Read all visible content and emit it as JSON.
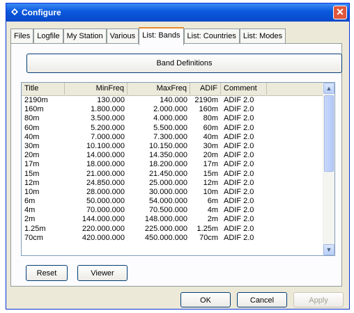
{
  "window": {
    "title": "Configure"
  },
  "tabs": [
    "Files",
    "Logfile",
    "My Station",
    "Various",
    "List: Bands",
    "List: Countries",
    "List: Modes"
  ],
  "active_tab": "List: Bands",
  "band_definitions_label": "Band Definitions",
  "columns": [
    "Title",
    "MinFreq",
    "MaxFreq",
    "ADIF",
    "Comment"
  ],
  "rows": [
    [
      "2190m",
      "130.000",
      "140.000",
      "2190m",
      "ADIF 2.0"
    ],
    [
      "160m",
      "1.800.000",
      "2.000.000",
      "160m",
      "ADIF 2.0"
    ],
    [
      "80m",
      "3.500.000",
      "4.000.000",
      "80m",
      "ADIF 2.0"
    ],
    [
      "60m",
      "5.200.000",
      "5.500.000",
      "60m",
      "ADIF 2.0"
    ],
    [
      "40m",
      "7.000.000",
      "7.300.000",
      "40m",
      "ADIF 2.0"
    ],
    [
      "30m",
      "10.100.000",
      "10.150.000",
      "30m",
      "ADIF 2.0"
    ],
    [
      "20m",
      "14.000.000",
      "14.350.000",
      "20m",
      "ADIF 2.0"
    ],
    [
      "17m",
      "18.000.000",
      "18.200.000",
      "17m",
      "ADIF 2.0"
    ],
    [
      "15m",
      "21.000.000",
      "21.450.000",
      "15m",
      "ADIF 2.0"
    ],
    [
      "12m",
      "24.850.000",
      "25.000.000",
      "12m",
      "ADIF 2.0"
    ],
    [
      "10m",
      "28.000.000",
      "30.000.000",
      "10m",
      "ADIF 2.0"
    ],
    [
      "6m",
      "50.000.000",
      "54.000.000",
      "6m",
      "ADIF 2.0"
    ],
    [
      "4m",
      "70.000.000",
      "70.500.000",
      "4m",
      "ADIF 2.0"
    ],
    [
      "2m",
      "144.000.000",
      "148.000.000",
      "2m",
      "ADIF 2.0"
    ],
    [
      "1.25m",
      "220.000.000",
      "225.000.000",
      "1.25m",
      "ADIF 2.0"
    ],
    [
      "70cm",
      "420.000.000",
      "450.000.000",
      "70cm",
      "ADIF 2.0"
    ]
  ],
  "buttons": {
    "reset": "Reset",
    "viewer": "Viewer",
    "ok": "OK",
    "cancel": "Cancel",
    "apply": "Apply"
  },
  "colors": {
    "titlebar": "#0a58dc",
    "close": "#e1573c",
    "tab_highlight": "#e68b2c"
  }
}
